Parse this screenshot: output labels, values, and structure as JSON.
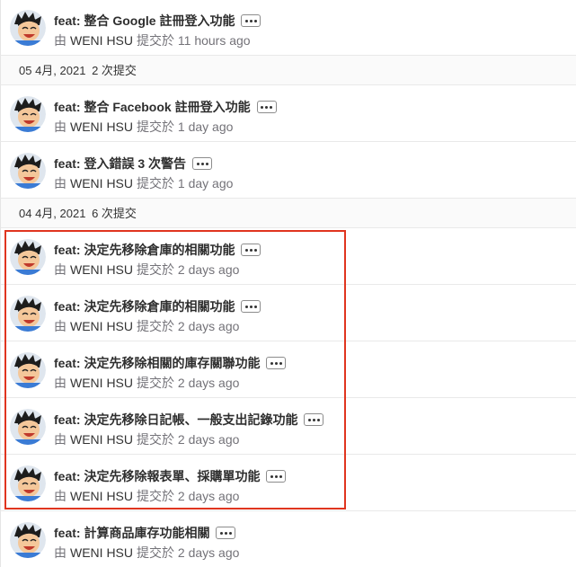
{
  "groups": [
    {
      "header": null,
      "commits": [
        {
          "title": "feat: 整合 Google 註冊登入功能",
          "author_prefix": "由",
          "author": "WENI HSU",
          "verb": "提交於",
          "time": "11 hours ago"
        }
      ]
    },
    {
      "header": {
        "date": "05 4月, 2021",
        "count": "2 次提交"
      },
      "commits": [
        {
          "title": "feat: 整合 Facebook 註冊登入功能",
          "author_prefix": "由",
          "author": "WENI HSU",
          "verb": "提交於",
          "time": "1 day ago"
        },
        {
          "title": "feat: 登入錯誤 3 次警告",
          "author_prefix": "由",
          "author": "WENI HSU",
          "verb": "提交於",
          "time": "1 day ago"
        }
      ]
    },
    {
      "header": {
        "date": "04 4月, 2021",
        "count": "6 次提交"
      },
      "commits": [
        {
          "title": "feat: 決定先移除倉庫的相關功能",
          "author_prefix": "由",
          "author": "WENI HSU",
          "verb": "提交於",
          "time": "2 days ago"
        },
        {
          "title": "feat: 決定先移除倉庫的相關功能",
          "author_prefix": "由",
          "author": "WENI HSU",
          "verb": "提交於",
          "time": "2 days ago"
        },
        {
          "title": "feat: 決定先移除相關的庫存關聯功能",
          "author_prefix": "由",
          "author": "WENI HSU",
          "verb": "提交於",
          "time": "2 days ago"
        },
        {
          "title": "feat: 決定先移除日記帳、一般支出記錄功能",
          "author_prefix": "由",
          "author": "WENI HSU",
          "verb": "提交於",
          "time": "2 days ago"
        },
        {
          "title": "feat: 決定先移除報表單、採購單功能",
          "author_prefix": "由",
          "author": "WENI HSU",
          "verb": "提交於",
          "time": "2 days ago"
        },
        {
          "title": "feat: 計算商品庫存功能相關",
          "author_prefix": "由",
          "author": "WENI HSU",
          "verb": "提交於",
          "time": "2 days ago"
        }
      ]
    }
  ],
  "icons": {
    "avatar": "cartoon-avatar-icon",
    "more": "ellipsis-icon"
  },
  "colors": {
    "highlight": "#e0351f",
    "meta_text": "#737278",
    "header_bg": "#fafafa"
  }
}
